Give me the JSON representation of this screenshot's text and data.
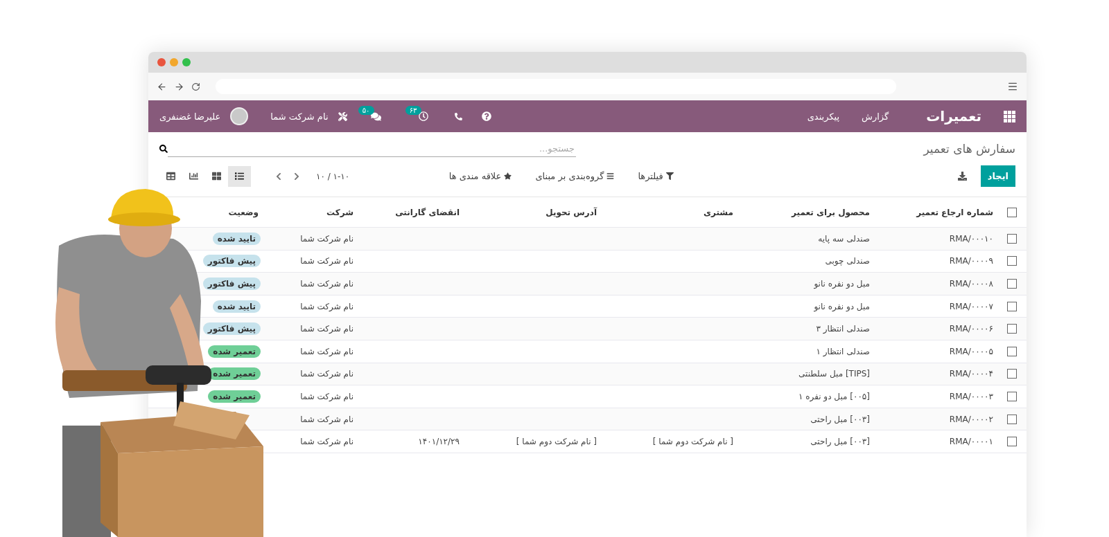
{
  "navbar": {
    "app_name": "تعمیرات",
    "menu": [
      "گزارش",
      "پیکربندی"
    ],
    "activity_count": "۶۳",
    "message_count": "۵۰",
    "company": "نام شرکت شما",
    "user": "علیرضا غضنفری"
  },
  "breadcrumb": "سفارش های تعمیر",
  "search": {
    "placeholder": "جستجو..."
  },
  "create_button": "ایجاد",
  "filters": [
    {
      "kind": "filter",
      "label": "فیلترها"
    },
    {
      "kind": "group",
      "label": "گروه‌بندی بر مبنای"
    },
    {
      "kind": "favorite",
      "label": "علاقه مندی ها"
    }
  ],
  "pager": "۱-۱۰ / ۱۰",
  "views": [
    {
      "kind": "list",
      "selected": true
    },
    {
      "kind": "kanban",
      "selected": false
    },
    {
      "kind": "graph",
      "selected": false
    },
    {
      "kind": "pivot",
      "selected": false
    }
  ],
  "table": {
    "select_all_checked": false,
    "columns": [
      "شماره ارجاع تعمیر",
      "محصول برای تعمیر",
      "مشتری",
      "آدرس تحویل",
      "انقضای گارانتی",
      "شرکت",
      "وضعیت"
    ],
    "rows": [
      {
        "checked": false,
        "reference": "RMA/۰۰۰۱۰",
        "product": "صندلی سه پایه",
        "company": "نام شرکت شما",
        "status": {
          "kind": "confirmed",
          "label": "تایید شده"
        }
      },
      {
        "checked": false,
        "reference": "RMA/۰۰۰۰۹",
        "product": "صندلی چوبی",
        "company": "نام شرکت شما",
        "status": {
          "kind": "quotation",
          "label": "پیش فاکتور"
        }
      },
      {
        "checked": false,
        "reference": "RMA/۰۰۰۰۸",
        "product": "مبل دو نفره نانو",
        "company": "نام شرکت شما",
        "status": {
          "kind": "quotation",
          "label": "پیش فاکتور"
        }
      },
      {
        "checked": false,
        "reference": "RMA/۰۰۰۰۷",
        "product": "مبل دو نفره نانو",
        "company": "نام شرکت شما",
        "status": {
          "kind": "confirmed",
          "label": "تایید شده"
        }
      },
      {
        "checked": false,
        "reference": "RMA/۰۰۰۰۶",
        "product": "صندلی انتظار ۳",
        "company": "نام شرکت شما",
        "status": {
          "kind": "quotation",
          "label": "پیش فاکتور"
        }
      },
      {
        "checked": false,
        "reference": "RMA/۰۰۰۰۵",
        "product": "صندلی انتظار ۱",
        "company": "نام شرکت شما",
        "status": {
          "kind": "repaired",
          "label": "تعمیر شده"
        }
      },
      {
        "checked": false,
        "reference": "RMA/۰۰۰۰۴",
        "product": "[TIPS] مبل سلطنتی",
        "company": "نام شرکت شما",
        "status": {
          "kind": "repaired",
          "label": "تعمیر شده"
        }
      },
      {
        "checked": false,
        "reference": "RMA/۰۰۰۰۳",
        "product": "[۰۰۵] مبل دو نفره ۱",
        "company": "نام شرکت شما",
        "status": {
          "kind": "repaired",
          "label": "تعمیر شده"
        }
      },
      {
        "checked": false,
        "reference": "RMA/۰۰۰۰۲",
        "product": "[۰۰۳] مبل راحتی",
        "company": "نام شرکت شما"
      },
      {
        "checked": false,
        "reference": "RMA/۰۰۰۰۱",
        "product": "[۰۰۳] مبل راحتی",
        "customer": "[ نام شرکت دوم شما ]",
        "address": "[ نام شرکت دوم شما ]",
        "warranty_expiry": "۱۴۰۱/۱۲/۲۹",
        "company": "نام شرکت شما"
      }
    ]
  }
}
